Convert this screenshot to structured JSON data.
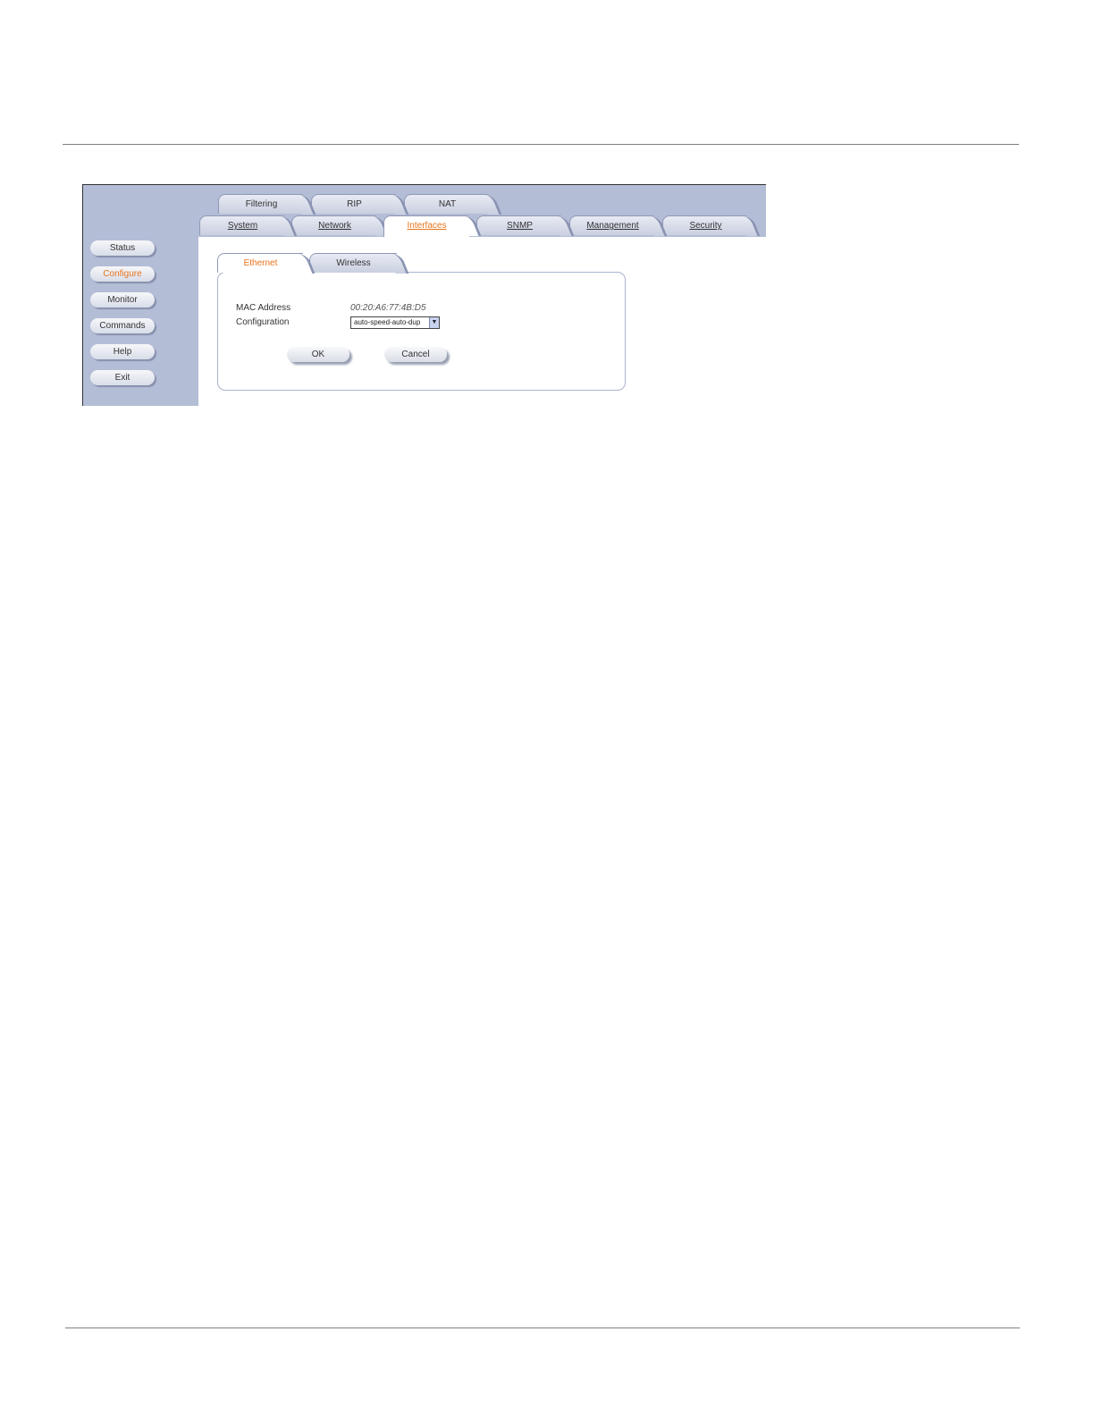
{
  "nav": {
    "items": [
      {
        "label": "Status",
        "active": false
      },
      {
        "label": "Configure",
        "active": true
      },
      {
        "label": "Monitor",
        "active": false
      },
      {
        "label": "Commands",
        "active": false
      },
      {
        "label": "Help",
        "active": false
      },
      {
        "label": "Exit",
        "active": false
      }
    ]
  },
  "tabs_row1": [
    {
      "label": "Filtering"
    },
    {
      "label": "RIP"
    },
    {
      "label": "NAT"
    }
  ],
  "tabs_row2": [
    {
      "label": "System"
    },
    {
      "label": "Network"
    },
    {
      "label": "Interfaces",
      "active": true
    },
    {
      "label": "SNMP"
    },
    {
      "label": "Management"
    },
    {
      "label": "Security"
    }
  ],
  "subtabs": [
    {
      "label": "Ethernet",
      "active": true
    },
    {
      "label": "Wireless",
      "active": false
    }
  ],
  "form": {
    "mac_label": "MAC Address",
    "mac_value": "00:20:A6:77:4B:D5",
    "config_label": "Configuration",
    "config_value": "auto-speed-auto-dup",
    "ok_label": "OK",
    "cancel_label": "Cancel"
  },
  "colors": {
    "nav_bg": "#b4bdd6",
    "active_text": "#e8731a"
  }
}
